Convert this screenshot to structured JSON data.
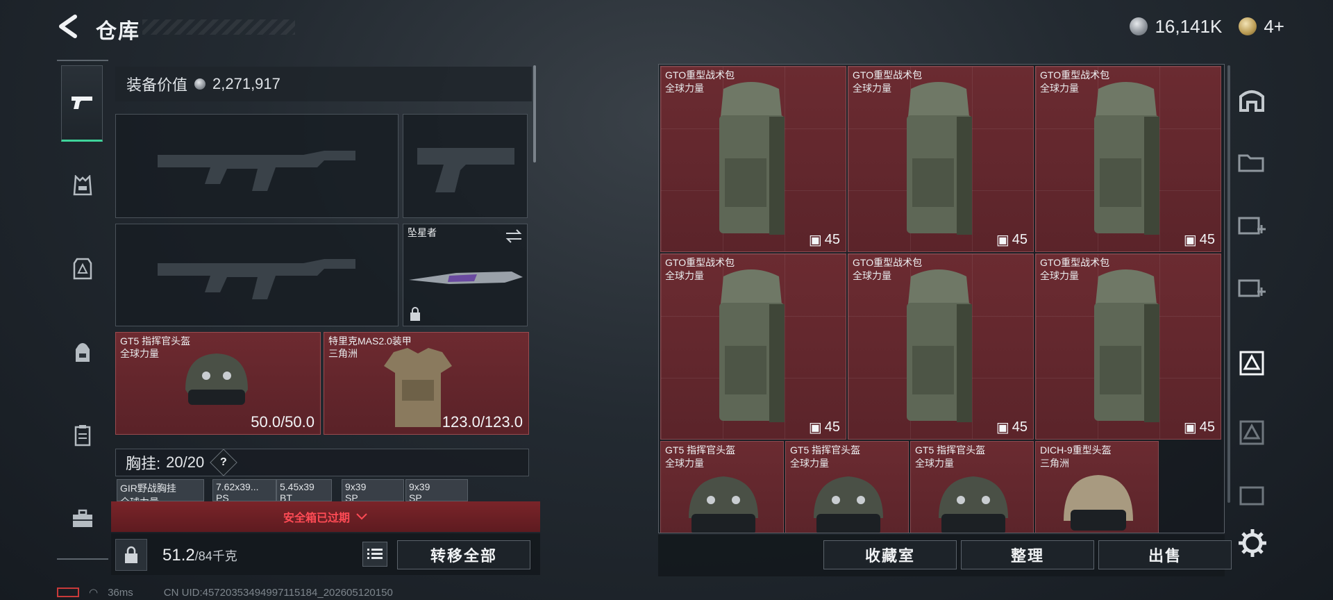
{
  "header": {
    "title": "仓库",
    "currency_amount": "16,141K",
    "premium_amount": "4+"
  },
  "left_nav": {
    "items": [
      "weapon",
      "vest",
      "armor",
      "backpack",
      "container",
      "toolbox"
    ]
  },
  "equipment": {
    "value_label": "装备价值",
    "value": "2,271,917",
    "melee_name": "坠星者",
    "helmet": {
      "name": "GT5 指挥官头盔",
      "faction": "全球力量",
      "durability": "50.0/50.0"
    },
    "armor": {
      "name": "特里克MAS2.0装甲",
      "faction": "三角洲",
      "durability": "123.0/123.0"
    },
    "vest_label": "胸挂:",
    "vest_count": "20/20",
    "vest_help": "?",
    "vest_slots": [
      {
        "name": "GIR野战胸挂",
        "sub": "全球力量"
      },
      {
        "name": "7.62x39...",
        "sub": "PS"
      },
      {
        "name": "5.45x39",
        "sub": "BT"
      },
      {
        "name": "9x39",
        "sub": "SP"
      },
      {
        "name": "9x39",
        "sub": "SP"
      }
    ],
    "safe_status": "安全箱已过期",
    "weight_current": "51.2",
    "weight_max": "/84千克",
    "transfer_all": "转移全部"
  },
  "stash": {
    "big_items": [
      {
        "name": "GTO重型战术包",
        "faction": "全球力量",
        "capacity": "45"
      },
      {
        "name": "GTO重型战术包",
        "faction": "全球力量",
        "capacity": "45"
      },
      {
        "name": "GTO重型战术包",
        "faction": "全球力量",
        "capacity": "45"
      },
      {
        "name": "GTO重型战术包",
        "faction": "全球力量",
        "capacity": "45"
      },
      {
        "name": "GTO重型战术包",
        "faction": "全球力量",
        "capacity": "45"
      },
      {
        "name": "GTO重型战术包",
        "faction": "全球力量",
        "capacity": "45"
      }
    ],
    "helmets": [
      {
        "name": "GT5 指挥官头盔",
        "faction": "全球力量"
      },
      {
        "name": "GT5 指挥官头盔",
        "faction": "全球力量"
      },
      {
        "name": "GT5 指挥官头盔",
        "faction": "全球力量"
      },
      {
        "name": "DICH-9重型头盔",
        "faction": "三角洲"
      }
    ],
    "buttons": {
      "collection": "收藏室",
      "sort": "整理",
      "sell": "出售"
    }
  },
  "right_nav": [
    "room-icon",
    "folder-icon",
    "add-container-icon",
    "add-container-icon",
    "armor-slot-icon",
    "armor-slot-icon",
    "storage-icon"
  ],
  "footer": {
    "ping": "36ms",
    "uid": "CN UID:45720353494997115184_202605120150"
  },
  "colors": {
    "item_bg": "#5b242a",
    "accent_green": "#3fd49b",
    "warning_red": "#ff4b55"
  }
}
